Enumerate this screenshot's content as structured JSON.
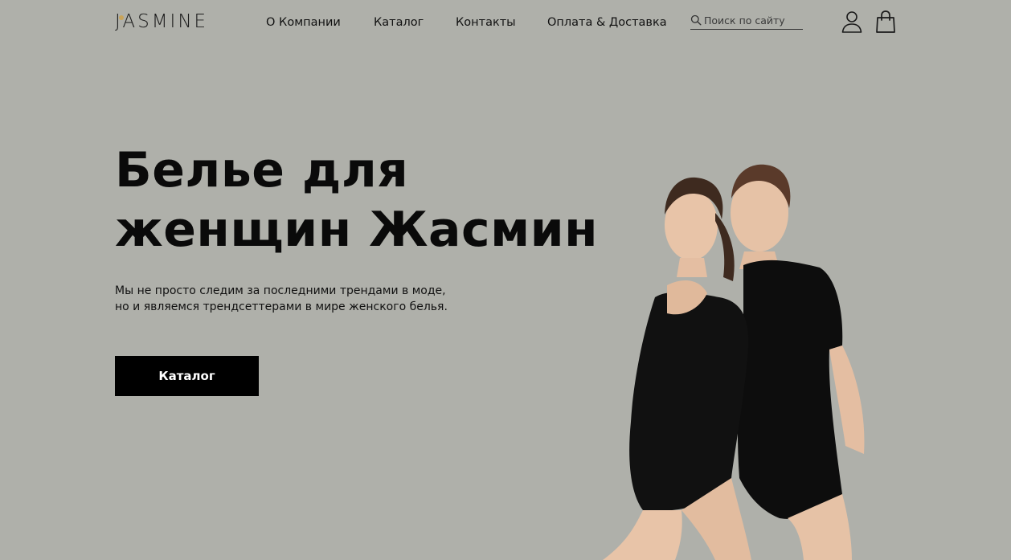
{
  "brand": {
    "logo_text": "JASMINE"
  },
  "nav": {
    "items": [
      {
        "label": "О Компании"
      },
      {
        "label": "Каталог"
      },
      {
        "label": "Контакты"
      },
      {
        "label": "Оплата & Доставка"
      }
    ]
  },
  "search": {
    "placeholder": "Поиск по сайту",
    "value": ""
  },
  "icons": {
    "search": "search-icon",
    "user": "user-icon",
    "cart": "shopping-bag-icon"
  },
  "hero": {
    "title_line1": "Белье для",
    "title_line2": "женщин Жасмин",
    "text_line1": "Мы не просто следим за последними трендами в моде,",
    "text_line2": "но и являемся трендсеттерами в мире женского белья.",
    "cta_label": "Каталог"
  },
  "colors": {
    "background": "#afb0aa",
    "accent": "#c9a45a",
    "button_bg": "#000000",
    "button_text": "#ffffff"
  }
}
